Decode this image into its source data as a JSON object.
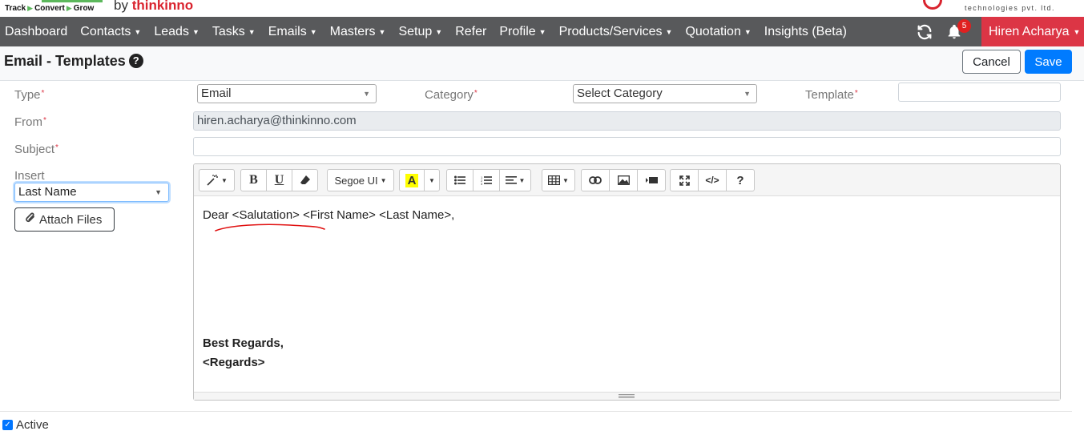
{
  "brand": {
    "tagline_track": "Track",
    "tagline_convert": "Convert",
    "tagline_grow": "Grow",
    "by": "by",
    "company": "thinkinno",
    "logo_sub": "technologies pvt. ltd."
  },
  "nav": {
    "items": [
      {
        "label": "Dashboard",
        "dropdown": false
      },
      {
        "label": "Contacts",
        "dropdown": true
      },
      {
        "label": "Leads",
        "dropdown": true
      },
      {
        "label": "Tasks",
        "dropdown": true
      },
      {
        "label": "Emails",
        "dropdown": true
      },
      {
        "label": "Masters",
        "dropdown": true
      },
      {
        "label": "Setup",
        "dropdown": true
      },
      {
        "label": "Refer",
        "dropdown": false
      },
      {
        "label": "Profile",
        "dropdown": true
      },
      {
        "label": "Products/Services",
        "dropdown": true
      },
      {
        "label": "Quotation",
        "dropdown": true
      },
      {
        "label": "Insights (Beta)",
        "dropdown": false
      }
    ],
    "notification_count": "5",
    "user_name": "Hiren Acharya"
  },
  "header": {
    "title": "Email - Templates",
    "cancel_label": "Cancel",
    "save_label": "Save"
  },
  "form": {
    "type_label": "Type",
    "type_value": "Email",
    "category_label": "Category",
    "category_value": "Select Category",
    "template_label": "Template",
    "template_value": "",
    "from_label": "From",
    "from_value": "hiren.acharya@thinkinno.com",
    "subject_label": "Subject",
    "subject_value": "",
    "insert_label": "Insert",
    "insert_value": "Last Name",
    "attach_label": "Attach Files",
    "active_label": "Active",
    "active_checked": true
  },
  "editor": {
    "font_name": "Segoe UI",
    "lines": {
      "greeting": "Dear <Salutation> <First Name> <Last Name>,",
      "closing": "Best Regards,",
      "signature": "<Regards>"
    }
  },
  "colors": {
    "nav_bg": "#58595b",
    "user_menu_bg": "#dc3545",
    "primary": "#007bff",
    "brand_red": "#d9232e",
    "annotation_red": "#e01010"
  }
}
